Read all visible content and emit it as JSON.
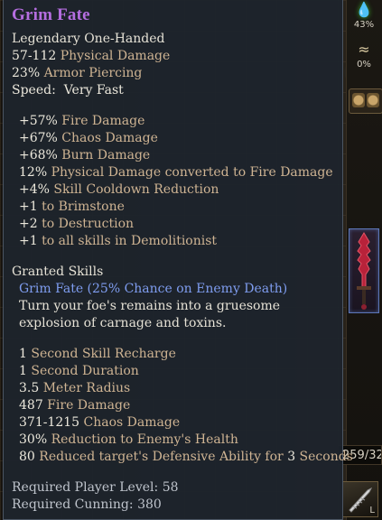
{
  "hud": {
    "acid_resist": "43%",
    "wind_resist": "0%",
    "health_readout": "259/32",
    "skill_hotkey": "L"
  },
  "item": {
    "name": "Grim Fate",
    "type": "Legendary One-Handed",
    "base_stats": [
      {
        "value": "57-112",
        "label": " Physical Damage"
      },
      {
        "value": "23%",
        "label": " Armor Piercing"
      },
      {
        "value": "Speed:",
        "label": "  Very Fast"
      }
    ],
    "affixes": [
      {
        "value": "+57%",
        "label": " Fire Damage"
      },
      {
        "value": "+67%",
        "label": " Chaos Damage"
      },
      {
        "value": "+68%",
        "label": " Burn Damage"
      },
      {
        "value": "12%",
        "label": " Physical Damage converted to Fire Damage"
      },
      {
        "value": "+4%",
        "label": " Skill Cooldown Reduction"
      },
      {
        "value": "+1",
        "label": " to Brimstone"
      },
      {
        "value": "+2",
        "label": " to Destruction"
      },
      {
        "value": "+1",
        "label": " to all skills in Demolitionist"
      }
    ],
    "granted_skills": {
      "heading": "Granted Skills",
      "skill_name": "Grim Fate (25% Chance on Enemy Death)",
      "description": [
        "Turn your foe's remains into a gruesome",
        "explosion of carnage and toxins."
      ],
      "stats": [
        {
          "value": "1",
          "label": " Second Skill Recharge"
        },
        {
          "value": "1",
          "label": " Second Duration"
        },
        {
          "value": "3.5",
          "label": " Meter Radius"
        },
        {
          "value": "487",
          "label": " Fire Damage"
        },
        {
          "value": "371-1215",
          "label": " Chaos Damage"
        },
        {
          "value": "30%",
          "label": " Reduction to Enemy's Health"
        },
        {
          "value": "80",
          "label": " Reduced target's Defensive Ability for ",
          "value2": "3",
          "label2": " Seconds"
        }
      ]
    },
    "requirements": [
      {
        "label": "Required Player Level: ",
        "value": "58"
      },
      {
        "label": "Required Cunning: ",
        "value": "380"
      }
    ]
  },
  "colors": {
    "legendary_name": "#b56ee0",
    "skill_name": "#7f9df0",
    "stat_label": "#cfb493",
    "text": "#e6e2d6",
    "tooltip_bg": "#1e242c"
  },
  "icons": {
    "acid": "acid-drop-icon",
    "wind": "whirlwind-icon",
    "weapon": "serrated-blade-icon",
    "skill": "feather-blade-icon"
  }
}
